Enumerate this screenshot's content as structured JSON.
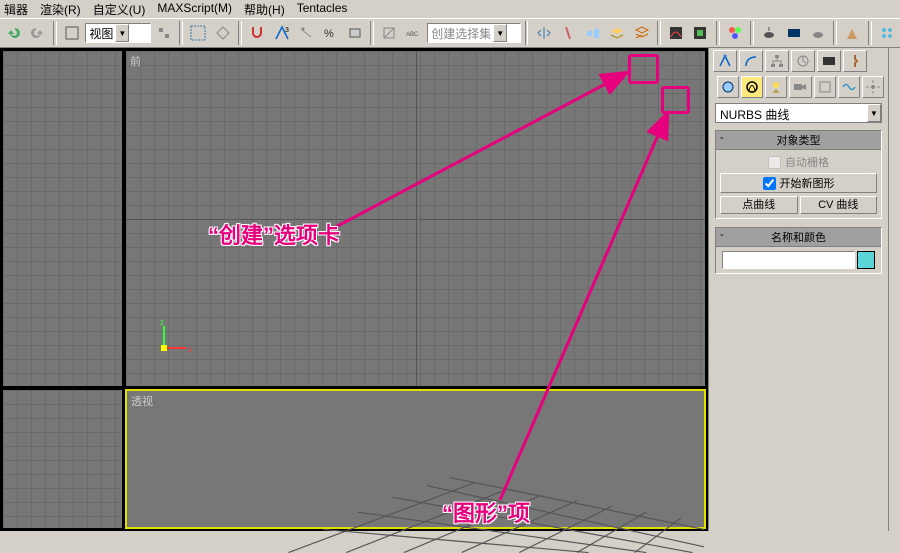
{
  "menu": {
    "editor": "辑器",
    "render": "渲染(R)",
    "custom": "自定义(U)",
    "maxscript": "MAXScript(M)",
    "help": "帮助(H)",
    "tentacles": "Tentacles"
  },
  "toolbar": {
    "view_dropdown": "视图",
    "selectset_placeholder": "创建选择集"
  },
  "viewports": {
    "front": "前",
    "persp": "透视",
    "gizmo": {
      "x": "x",
      "z": "z"
    }
  },
  "panel": {
    "dropdown": "NURBS 曲线",
    "rollout_objtype": "对象类型",
    "auto_grid": "自动栅格",
    "start_new_shape": "开始新图形",
    "btn_point_curve": "点曲线",
    "btn_cv_curve": "CV 曲线",
    "rollout_namecolor": "名称和颜色"
  },
  "annotations": {
    "create_tab": "“创建”选项卡",
    "shape_item": "“图形”项"
  }
}
